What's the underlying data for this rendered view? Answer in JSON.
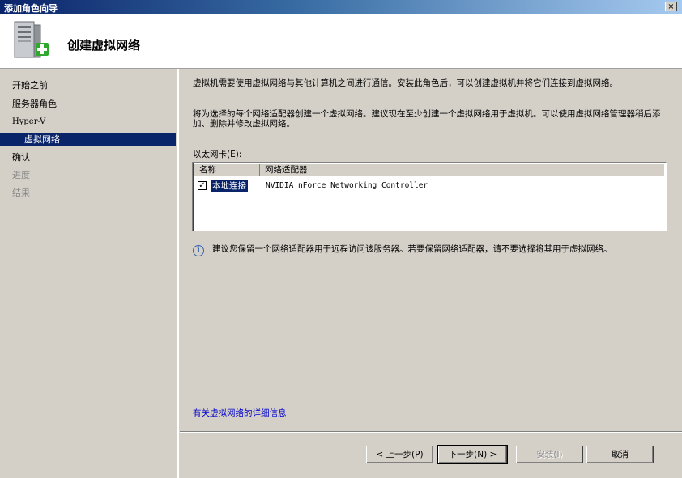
{
  "window": {
    "title": "添加角色向导",
    "close_label": "×"
  },
  "header": {
    "title": "创建虚拟网络",
    "icon": "server-add-icon"
  },
  "sidebar": {
    "items": [
      {
        "label": "开始之前",
        "state": "normal"
      },
      {
        "label": "服务器角色",
        "state": "normal"
      },
      {
        "label": "Hyper-V",
        "state": "normal"
      },
      {
        "label": "虚拟网络",
        "state": "selected"
      },
      {
        "label": "确认",
        "state": "normal"
      },
      {
        "label": "进度",
        "state": "disabled"
      },
      {
        "label": "结果",
        "state": "disabled"
      }
    ]
  },
  "main": {
    "intro_paragraph": "虚拟机需要使用虚拟网络与其他计算机之间进行通信。安装此角色后，可以创建虚拟机并将它们连接到虚拟网络。",
    "instruction_paragraph": "将为选择的每个网络适配器创建一个虚拟网络。建议现在至少创建一个虚拟网络用于虚拟机。可以使用虚拟网络管理器稍后添加、删除并修改虚拟网络。",
    "ethernet_label": "以太网卡(E):",
    "table": {
      "columns": [
        "名称",
        "网络适配器",
        ""
      ],
      "rows": [
        {
          "checked": true,
          "name": "本地连接",
          "adapter": "NVIDIA nForce Networking Controller"
        }
      ]
    },
    "info_text": "建议您保留一个网络适配器用于远程访问该服务器。若要保留网络适配器，请不要选择将其用于虚拟网络。",
    "more_info_link": "有关虚拟网络的详细信息"
  },
  "buttons": {
    "prev": "< 上一步(P)",
    "next": "下一步(N) >",
    "install": "安装(I)",
    "cancel": "取消"
  }
}
